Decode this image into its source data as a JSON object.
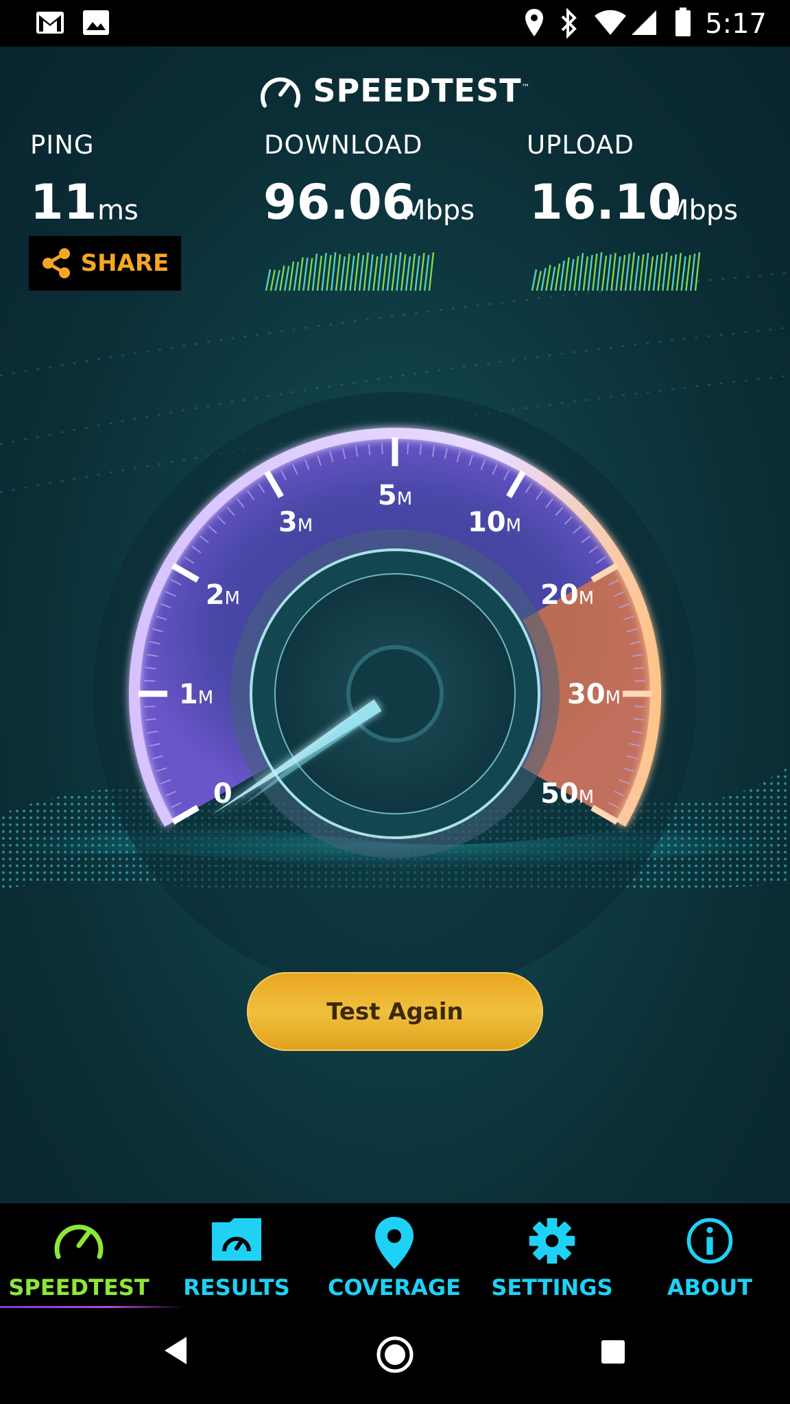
{
  "status_bar": {
    "time": "5:17",
    "icons": [
      "gmail-icon",
      "photo-icon",
      "location-icon",
      "bluetooth-icon",
      "wifi-icon",
      "signal-icon",
      "battery-icon"
    ]
  },
  "header": {
    "logo_text": "SPEEDTEST",
    "trademark": "™"
  },
  "metrics": {
    "ping": {
      "label": "PING",
      "value": "11",
      "unit": "ms"
    },
    "download": {
      "label": "DOWNLOAD",
      "value": "96.06",
      "unit": "Mbps"
    },
    "upload": {
      "label": "UPLOAD",
      "value": "16.10",
      "unit": "Mbps"
    }
  },
  "share_button": {
    "label": "SHARE"
  },
  "gauge": {
    "ticks": [
      {
        "num": "0",
        "unit": ""
      },
      {
        "num": "1",
        "unit": "M"
      },
      {
        "num": "2",
        "unit": "M"
      },
      {
        "num": "3",
        "unit": "M"
      },
      {
        "num": "5",
        "unit": "M"
      },
      {
        "num": "10",
        "unit": "M"
      },
      {
        "num": "20",
        "unit": "M"
      },
      {
        "num": "30",
        "unit": "M"
      },
      {
        "num": "50",
        "unit": "M"
      }
    ],
    "needle_value": "0",
    "colors": {
      "rim": "#c9a7ff",
      "accent": "#ff8c3a",
      "needle": "#bdf3ff"
    }
  },
  "test_again_button": {
    "label": "Test Again"
  },
  "tab_bar": {
    "tabs": [
      {
        "label": "SPEEDTEST",
        "icon": "gauge-icon",
        "active": true
      },
      {
        "label": "RESULTS",
        "icon": "results-folder-icon",
        "active": false
      },
      {
        "label": "COVERAGE",
        "icon": "location-pin-icon",
        "active": false
      },
      {
        "label": "SETTINGS",
        "icon": "gear-icon",
        "active": false
      },
      {
        "label": "ABOUT",
        "icon": "info-icon",
        "active": false
      }
    ],
    "active_color": "#8ee63a",
    "inactive_color": "#1fd1f5"
  },
  "nav_bar": {
    "icons": [
      "back-icon",
      "home-icon",
      "recents-icon"
    ]
  }
}
